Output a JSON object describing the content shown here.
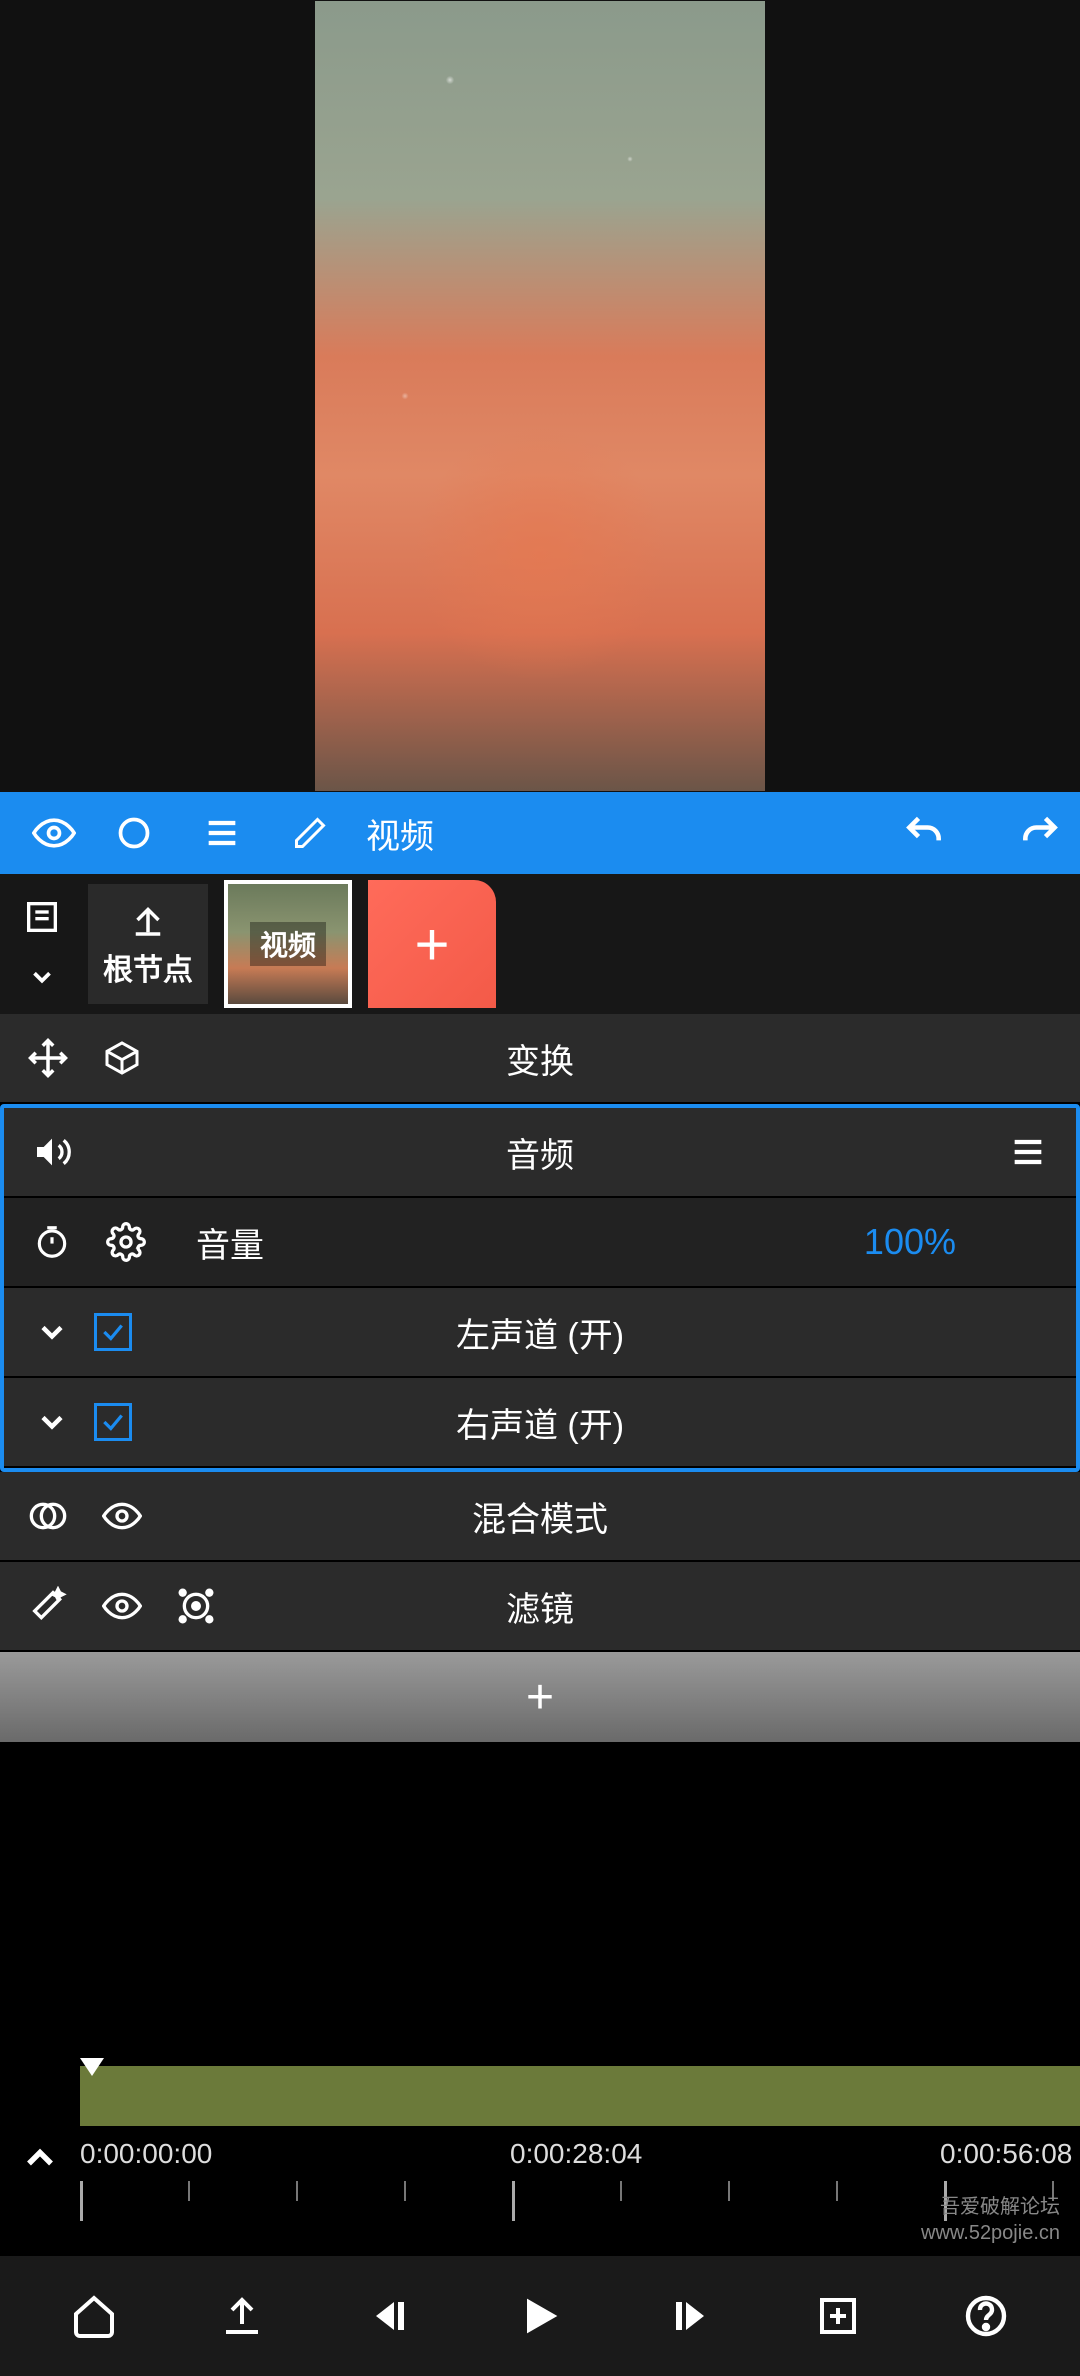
{
  "toolbar": {
    "title": "视频"
  },
  "layers": {
    "root_label": "根节点",
    "video_thumb_label": "视频"
  },
  "panels": {
    "transform": "变换",
    "audio": "音频",
    "volume_label": "音量",
    "volume_value": "100%",
    "left_channel": "左声道 (开)",
    "right_channel": "右声道 (开)",
    "blend_mode": "混合模式",
    "filter": "滤镜"
  },
  "timeline": {
    "t0": "0:00:00:00",
    "t1": "0:00:28:04",
    "t2": "0:00:56:08"
  },
  "watermark": {
    "line1": "吾爱破解论坛",
    "line2": "www.52pojie.cn"
  }
}
